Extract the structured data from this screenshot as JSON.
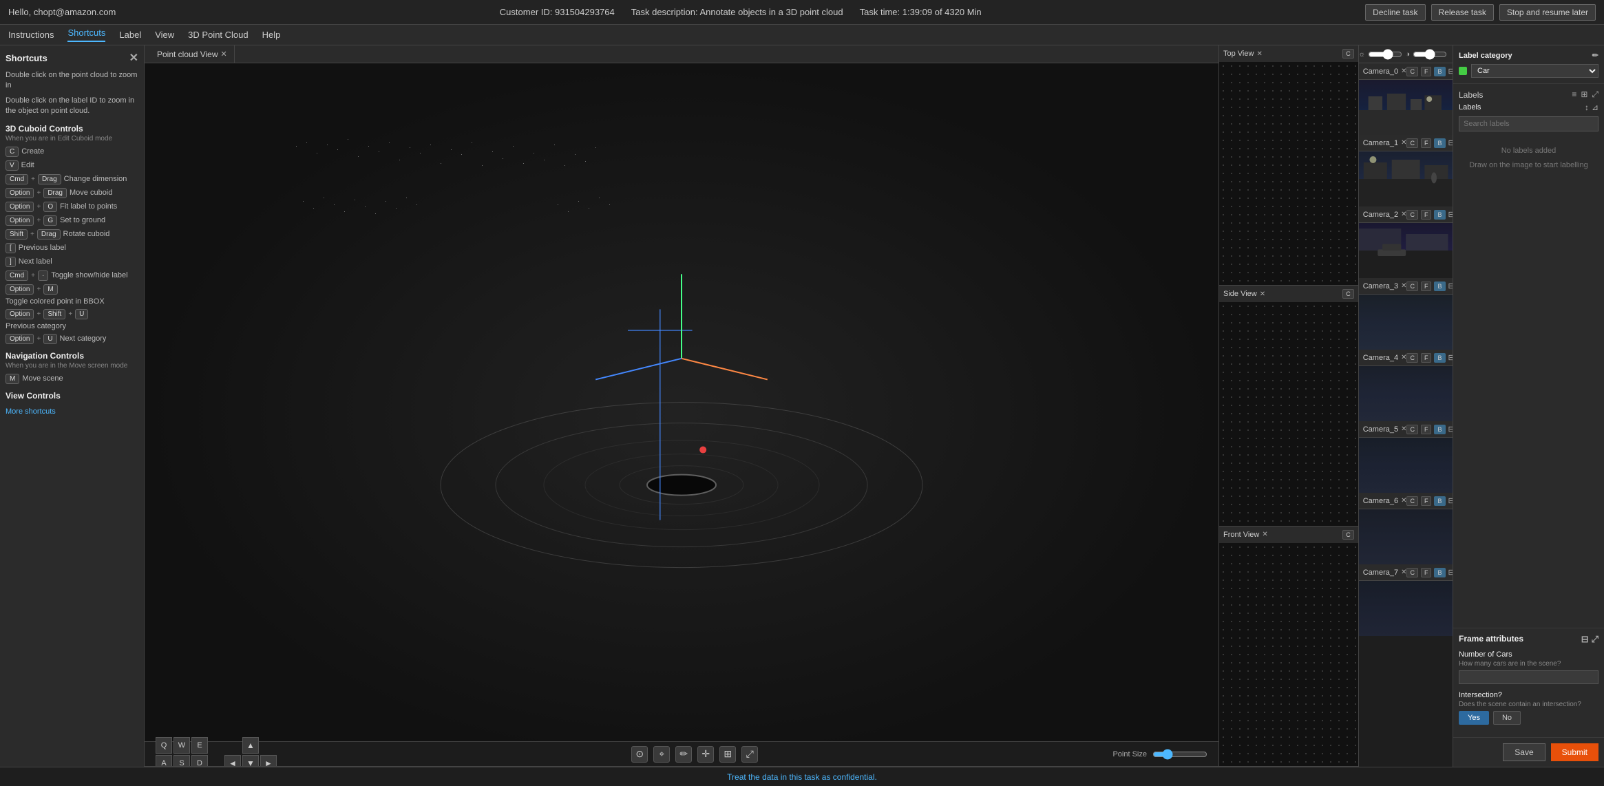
{
  "topbar": {
    "user": "Hello, chopt@amazon.com",
    "customer_id": "Customer ID: 931504293764",
    "task_description": "Task description: Annotate objects in a 3D point cloud",
    "task_time": "Task time: 1:39:09 of 4320 Min",
    "decline_btn": "Decline task",
    "release_btn": "Release task",
    "stop_resume_btn": "Stop and resume later"
  },
  "menubar": {
    "items": [
      "Instructions",
      "Shortcuts",
      "Label",
      "View",
      "3D Point Cloud",
      "Help"
    ]
  },
  "shortcuts_panel": {
    "title": "Shortcuts",
    "desc1": "Double click on the point cloud to zoom in",
    "desc2": "Double click on the label ID to zoom in the object on point cloud.",
    "cuboid_title": "3D Cuboid Controls",
    "cuboid_sub": "When you are in Edit Cuboid mode",
    "shortcuts": [
      {
        "keys": [
          "C"
        ],
        "label": "Create"
      },
      {
        "keys": [
          "V"
        ],
        "label": "Edit"
      },
      {
        "keys": [
          "Cmd",
          "+",
          "Drag"
        ],
        "label": "Change dimension"
      },
      {
        "keys": [
          "Option",
          "+",
          "Drag"
        ],
        "label": "Move cuboid"
      },
      {
        "keys": [
          "Option",
          "+",
          "O"
        ],
        "label": "Fit label to points"
      },
      {
        "keys": [
          "Option",
          "+",
          "G"
        ],
        "label": "Set to ground"
      },
      {
        "keys": [
          "Shift",
          "+",
          "Drag"
        ],
        "label": "Rotate cuboid"
      },
      {
        "keys": [
          "["
        ],
        "label": "Previous label"
      },
      {
        "keys": [
          "]"
        ],
        "label": "Next label"
      },
      {
        "keys": [
          "Cmd",
          "+",
          "·"
        ],
        "label": "Toggle show/hide label"
      },
      {
        "keys": [
          "Option",
          "+",
          "M"
        ],
        "label": "Toggle colored point in BBOX"
      },
      {
        "keys": [
          "Option",
          "+",
          "Shift",
          "+",
          "U"
        ],
        "label": "Previous category"
      },
      {
        "keys": [
          "Option",
          "+",
          "U"
        ],
        "label": "Next category"
      }
    ],
    "nav_title": "Navigation Controls",
    "nav_sub": "When you are in the Move screen mode",
    "nav_shortcuts": [
      {
        "keys": [
          "M"
        ],
        "label": "Move scene"
      }
    ],
    "view_title": "View Controls",
    "more_shortcuts": "More shortcuts"
  },
  "views": {
    "point_cloud": "Point cloud View",
    "top": "Top View",
    "side": "Side View",
    "front": "Front View"
  },
  "cameras": [
    {
      "name": "Camera_0",
      "buttons": [
        "C",
        "F",
        "B"
      ]
    },
    {
      "name": "Camera_1",
      "buttons": [
        "C",
        "F",
        "B"
      ]
    },
    {
      "name": "Camera_2",
      "buttons": [
        "C",
        "F",
        "B"
      ]
    },
    {
      "name": "Camera_3",
      "buttons": [
        "C",
        "F",
        "B"
      ]
    },
    {
      "name": "Camera_4",
      "buttons": [
        "C",
        "F",
        "B"
      ]
    },
    {
      "name": "Camera_5",
      "buttons": [
        "C",
        "F",
        "B"
      ]
    },
    {
      "name": "Camera_6",
      "buttons": [
        "C",
        "F",
        "B"
      ]
    },
    {
      "name": "Camera_7",
      "buttons": [
        "C",
        "F",
        "B"
      ]
    }
  ],
  "annotation": {
    "label_category_title": "Label category",
    "category_value": "Car",
    "labels_title": "Labels",
    "search_placeholder": "Search labels",
    "no_labels_line1": "No labels added",
    "no_labels_line2": "Draw on the image to start labelling",
    "frame_attrs_title": "Frame attributes",
    "num_cars_label": "Number of Cars",
    "num_cars_sub": "How many cars are in the scene?",
    "intersection_label": "Intersection?",
    "intersection_sub": "Does the scene contain an intersection?",
    "yes_btn": "Yes",
    "no_btn": "No"
  },
  "toolbar": {
    "point_size_label": "Point Size",
    "save_btn": "Save",
    "submit_btn": "Submit",
    "nav_keys": [
      "Q",
      "W",
      "E",
      "A",
      "S",
      "D"
    ]
  },
  "statusbar": {
    "message": "Treat the data in this task as confidential."
  }
}
